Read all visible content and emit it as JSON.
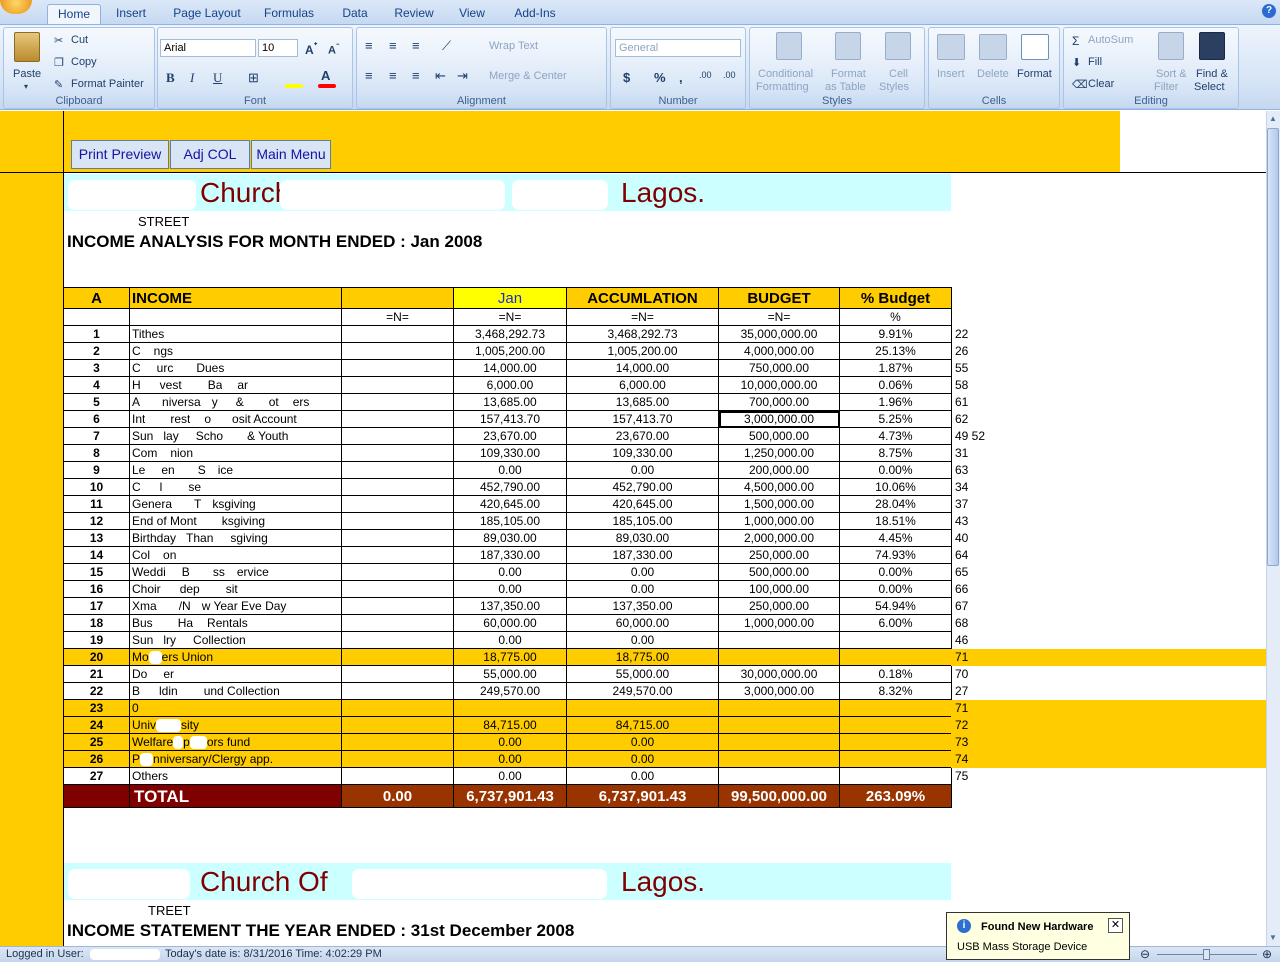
{
  "tabs": [
    "Home",
    "Insert",
    "Page Layout",
    "Formulas",
    "Data",
    "Review",
    "View",
    "Add-Ins"
  ],
  "ribbon": {
    "clipboard": {
      "paste": "Paste",
      "cut": "Cut",
      "copy": "Copy",
      "painter": "Format Painter",
      "label": "Clipboard"
    },
    "font": {
      "name": "Arial",
      "size": "10",
      "label": "Font"
    },
    "alignment": {
      "wrap": "Wrap Text",
      "merge": "Merge & Center",
      "label": "Alignment"
    },
    "number": {
      "format": "General",
      "label": "Number"
    },
    "styles": {
      "cond1": "Conditional",
      "cond2": "Formatting",
      "fmt1": "Format",
      "fmt2": "as Table",
      "cell1": "Cell",
      "cell2": "Styles",
      "label": "Styles"
    },
    "cells": {
      "insert": "Insert",
      "delete": "Delete",
      "format": "Format",
      "label": "Cells"
    },
    "editing": {
      "autosum": "AutoSum",
      "fill": "Fill",
      "clear": "Clear",
      "sort1": "Sort &",
      "sort2": "Filter",
      "find1": "Find &",
      "find2": "Select",
      "label": "Editing"
    }
  },
  "macro_buttons": [
    "Print Preview",
    "Adj COL",
    "Main Menu"
  ],
  "sheet": {
    "church_suffix": "Lagos.",
    "church_mid": "Church Of",
    "street": "STREET",
    "heading": "INCOME ANALYSIS FOR MONTH ENDED :  Jan 2008",
    "headers": [
      "A",
      "INCOME",
      "",
      "Jan",
      "ACCUMLATION",
      "BUDGET",
      "% Budget"
    ],
    "units": [
      "",
      "",
      "=N=",
      "=N=",
      "=N=",
      "=N=",
      "%"
    ],
    "rows": [
      {
        "n": "1",
        "label": "Tithes",
        "jan": "3,468,292.73",
        "acc": "3,468,292.73",
        "bud": "35,000,000.00",
        "pct": "9.91%",
        "ref": "22",
        "y": false
      },
      {
        "n": "2",
        "label": "",
        "jan": "1,005,200.00",
        "acc": "1,005,200.00",
        "bud": "4,000,000.00",
        "pct": "25.13%",
        "ref": "26",
        "y": false
      },
      {
        "n": "3",
        "label": "",
        "jan": "14,000.00",
        "acc": "14,000.00",
        "bud": "750,000.00",
        "pct": "1.87%",
        "ref": "55",
        "y": false
      },
      {
        "n": "4",
        "label": "",
        "jan": "6,000.00",
        "acc": "6,000.00",
        "bud": "10,000,000.00",
        "pct": "0.06%",
        "ref": "58",
        "y": false
      },
      {
        "n": "5",
        "label": "",
        "jan": "13,685.00",
        "acc": "13,685.00",
        "bud": "700,000.00",
        "pct": "1.96%",
        "ref": "61",
        "y": false
      },
      {
        "n": "6",
        "label": "",
        "jan": "157,413.70",
        "acc": "157,413.70",
        "bud": "3,000,000.00",
        "pct": "5.25%",
        "ref": "62",
        "y": false
      },
      {
        "n": "7",
        "label": "",
        "jan": "23,670.00",
        "acc": "23,670.00",
        "bud": "500,000.00",
        "pct": "4.73%",
        "ref": "49  52",
        "y": false
      },
      {
        "n": "8",
        "label": "",
        "jan": "109,330.00",
        "acc": "109,330.00",
        "bud": "1,250,000.00",
        "pct": "8.75%",
        "ref": "31",
        "y": false
      },
      {
        "n": "9",
        "label": "",
        "jan": "0.00",
        "acc": "0.00",
        "bud": "200,000.00",
        "pct": "0.00%",
        "ref": "63",
        "y": false
      },
      {
        "n": "10",
        "label": "",
        "jan": "452,790.00",
        "acc": "452,790.00",
        "bud": "4,500,000.00",
        "pct": "10.06%",
        "ref": "34",
        "y": false
      },
      {
        "n": "11",
        "label": "",
        "jan": "420,645.00",
        "acc": "420,645.00",
        "bud": "1,500,000.00",
        "pct": "28.04%",
        "ref": "37",
        "y": false
      },
      {
        "n": "12",
        "label": "",
        "jan": "185,105.00",
        "acc": "185,105.00",
        "bud": "1,000,000.00",
        "pct": "18.51%",
        "ref": "43",
        "y": false
      },
      {
        "n": "13",
        "label": "",
        "jan": "89,030.00",
        "acc": "89,030.00",
        "bud": "2,000,000.00",
        "pct": "4.45%",
        "ref": "40",
        "y": false
      },
      {
        "n": "14",
        "label": "",
        "jan": "187,330.00",
        "acc": "187,330.00",
        "bud": "250,000.00",
        "pct": "74.93%",
        "ref": "64",
        "y": false
      },
      {
        "n": "15",
        "label": "",
        "jan": "0.00",
        "acc": "0.00",
        "bud": "500,000.00",
        "pct": "0.00%",
        "ref": "65",
        "y": false
      },
      {
        "n": "16",
        "label": "",
        "jan": "0.00",
        "acc": "0.00",
        "bud": "100,000.00",
        "pct": "0.00%",
        "ref": "66",
        "y": false
      },
      {
        "n": "17",
        "label": "",
        "jan": "137,350.00",
        "acc": "137,350.00",
        "bud": "250,000.00",
        "pct": "54.94%",
        "ref": "67",
        "y": false
      },
      {
        "n": "18",
        "label": "",
        "jan": "60,000.00",
        "acc": "60,000.00",
        "bud": "1,000,000.00",
        "pct": "6.00%",
        "ref": "68",
        "y": false
      },
      {
        "n": "19",
        "label": "",
        "jan": "0.00",
        "acc": "0.00",
        "bud": "",
        "pct": "",
        "ref": "46",
        "y": false
      },
      {
        "n": "20",
        "label": "",
        "jan": "18,775.00",
        "acc": "18,775.00",
        "bud": "",
        "pct": "",
        "ref": "71",
        "y": true
      },
      {
        "n": "21",
        "label": "",
        "jan": "55,000.00",
        "acc": "55,000.00",
        "bud": "30,000,000.00",
        "pct": "0.18%",
        "ref": "70",
        "y": false
      },
      {
        "n": "22",
        "label": "",
        "jan": "249,570.00",
        "acc": "249,570.00",
        "bud": "3,000,000.00",
        "pct": "8.32%",
        "ref": "27",
        "y": false
      },
      {
        "n": "23",
        "label": "0",
        "jan": "",
        "acc": "",
        "bud": "",
        "pct": "",
        "ref": "71",
        "y": true
      },
      {
        "n": "24",
        "label": "",
        "jan": "84,715.00",
        "acc": "84,715.00",
        "bud": "",
        "pct": "",
        "ref": "72",
        "y": true
      },
      {
        "n": "25",
        "label": "",
        "jan": "0.00",
        "acc": "0.00",
        "bud": "",
        "pct": "",
        "ref": "73",
        "y": true
      },
      {
        "n": "26",
        "label": "",
        "jan": "0.00",
        "acc": "0.00",
        "bud": "",
        "pct": "",
        "ref": "74",
        "y": true
      },
      {
        "n": "27",
        "label": "Others",
        "jan": "0.00",
        "acc": "0.00",
        "bud": "",
        "pct": "",
        "ref": "75",
        "y": false
      }
    ],
    "label_parts": {
      "r2": [
        "C",
        "ngs"
      ],
      "r3": [
        "C",
        "urc",
        "Dues"
      ],
      "r4": [
        "H",
        "vest",
        "Ba",
        "ar"
      ],
      "r5": [
        "A",
        "niversa",
        "y",
        "&",
        "ot",
        "ers"
      ],
      "r6": [
        "Int",
        "rest",
        "o",
        "osit Account"
      ],
      "r7": [
        "Sun",
        "lay",
        "Scho",
        "& Youth"
      ],
      "r8": [
        "Com",
        "nion"
      ],
      "r9": [
        "Le",
        "en",
        "S",
        "ice"
      ],
      "r10": [
        "C",
        "l",
        "se"
      ],
      "r11": [
        "Genera",
        "T",
        "ksgiving"
      ],
      "r12": [
        "End of Mont",
        "ksgiving"
      ],
      "r13": [
        "Birthday",
        "Than",
        "sgiving"
      ],
      "r14": [
        "Col",
        "on"
      ],
      "r15": [
        "Weddi",
        "B",
        "ss",
        "ervice"
      ],
      "r16": [
        "Choir",
        "dep",
        "sit"
      ],
      "r17": [
        "Xma",
        "/N",
        "w Year Eve Day"
      ],
      "r18": [
        "Bus",
        "Ha",
        "Rentals"
      ],
      "r19": [
        "Sun",
        "lry",
        "Collection"
      ],
      "r20": [
        "Mo",
        "ers Union"
      ],
      "r21": [
        "Do",
        "er"
      ],
      "r22": [
        "B",
        "ldin",
        "und Collection"
      ],
      "r24": [
        "Univ",
        "sity"
      ],
      "r25": [
        "Welfare",
        "p",
        "ors fund"
      ],
      "r26": [
        "P",
        "nniversary/Clergy app."
      ]
    },
    "totals": {
      "label": "TOTAL",
      "col3": "0.00",
      "jan": "6,737,901.43",
      "acc": "6,737,901.43",
      "bud": "99,500,000.00",
      "pct": "263.09%"
    },
    "heading2": "INCOME STATEMENT THE YEAR ENDED : 31st December 2008",
    "street2": "TREET"
  },
  "status": {
    "logged": "Logged in User:",
    "date": "Today's date is: 8/31/2016 Time: 4:02:29 PM"
  },
  "notification": {
    "title": "Found New Hardware",
    "body": "USB Mass Storage Device"
  }
}
